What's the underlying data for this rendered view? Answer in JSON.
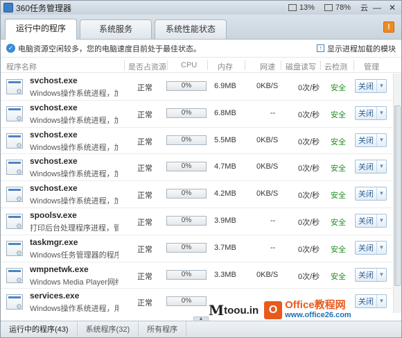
{
  "window": {
    "title": "360任务管理器",
    "cpu_pct": "13%",
    "mem_pct": "78%",
    "weather": "云",
    "min_glyph": "—",
    "close_glyph": "✕"
  },
  "tabs": [
    {
      "label": "运行中的程序",
      "active": true
    },
    {
      "label": "系统服务",
      "active": false
    },
    {
      "label": "系统性能状态",
      "active": false
    }
  ],
  "warn_glyph": "!",
  "status": {
    "message": "电脑资源空闲较多，您的电脑速度目前处于最佳状态。",
    "show_loaded": "显示进程加载的模块"
  },
  "columns": [
    "程序名称",
    "是否占资源",
    "CPU",
    "内存",
    "网速",
    "磁盘读写",
    "云检测",
    "管理"
  ],
  "rows": [
    {
      "name": "svchost.exe",
      "desc": "Windows操作系统进程，加...",
      "status": "正常",
      "cpu": "0%",
      "mem": "6.9MB",
      "net": "0KB/S",
      "disk": "0次/秒",
      "cloud": "安全",
      "action": "关闭"
    },
    {
      "name": "svchost.exe",
      "desc": "Windows操作系统进程，加...",
      "status": "正常",
      "cpu": "0%",
      "mem": "6.8MB",
      "net": "--",
      "disk": "0次/秒",
      "cloud": "安全",
      "action": "关闭"
    },
    {
      "name": "svchost.exe",
      "desc": "Windows操作系统进程，加...",
      "status": "正常",
      "cpu": "0%",
      "mem": "5.5MB",
      "net": "0KB/S",
      "disk": "0次/秒",
      "cloud": "安全",
      "action": "关闭"
    },
    {
      "name": "svchost.exe",
      "desc": "Windows操作系统进程，加...",
      "status": "正常",
      "cpu": "0%",
      "mem": "4.7MB",
      "net": "0KB/S",
      "disk": "0次/秒",
      "cloud": "安全",
      "action": "关闭"
    },
    {
      "name": "svchost.exe",
      "desc": "Windows操作系统进程，加...",
      "status": "正常",
      "cpu": "0%",
      "mem": "4.2MB",
      "net": "0KB/S",
      "disk": "0次/秒",
      "cloud": "安全",
      "action": "关闭"
    },
    {
      "name": "spoolsv.exe",
      "desc": "打印后台处理程序进程，管...",
      "status": "正常",
      "cpu": "0%",
      "mem": "3.9MB",
      "net": "--",
      "disk": "0次/秒",
      "cloud": "安全",
      "action": "关闭"
    },
    {
      "name": "taskmgr.exe",
      "desc": "Windows任务管理器的程序...",
      "status": "正常",
      "cpu": "0%",
      "mem": "3.7MB",
      "net": "--",
      "disk": "0次/秒",
      "cloud": "安全",
      "action": "关闭"
    },
    {
      "name": "wmpnetwk.exe",
      "desc": "Windows Media Player网络...",
      "status": "正常",
      "cpu": "0%",
      "mem": "3.3MB",
      "net": "0KB/S",
      "disk": "0次/秒",
      "cloud": "安全",
      "action": "关闭"
    },
    {
      "name": "services.exe",
      "desc": "Windows操作系统进程，用...",
      "status": "正常",
      "cpu": "0%",
      "mem": "",
      "net": "",
      "disk": "",
      "cloud": "",
      "action": "关闭"
    }
  ],
  "footer": [
    {
      "label": "运行中的程序(43)"
    },
    {
      "label": "系统程序(32)"
    },
    {
      "label": "所有程序"
    }
  ],
  "watermark": {
    "m": "M",
    "rest": "toou.in",
    "logo_letter": "O",
    "cn": "Office教程网",
    "url": "www.office26.com"
  },
  "colors": {
    "safe": "#1e8c1e",
    "accent": "#2b64a8",
    "warn": "#f08a20"
  }
}
